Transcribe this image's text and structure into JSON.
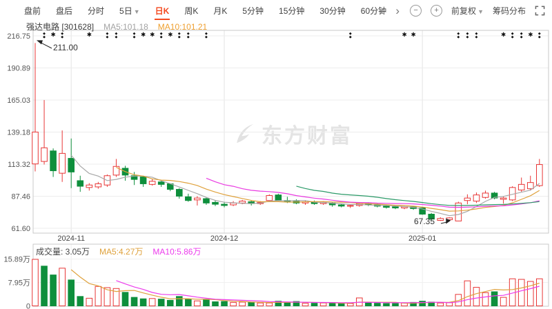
{
  "toolbar": {
    "tabs": [
      {
        "label": "盘前"
      },
      {
        "label": "盘后"
      },
      {
        "label": "分时"
      },
      {
        "label": "5日",
        "caret": true
      },
      {
        "label": "日K",
        "active": true
      },
      {
        "label": "周K"
      },
      {
        "label": "月K"
      },
      {
        "label": "5分钟"
      },
      {
        "label": "15分钟"
      },
      {
        "label": "30分钟"
      },
      {
        "label": "60分钟"
      }
    ],
    "controls": {
      "prev": "‹",
      "next": "›",
      "zoom_out": "−",
      "zoom_in": "+",
      "adjust_label": "前复权",
      "chip_label": "筹码分布"
    }
  },
  "legend": {
    "stock_name": "强达电路",
    "stock_code": "[301628]",
    "ma5": "MA5:101.18",
    "ma10": "MA10:101.21"
  },
  "volume_legend": {
    "volume": "成交量: 3.05万",
    "ma5": "MA5:4.27万",
    "ma10": "MA10:5.86万"
  },
  "watermark": "东方财富",
  "annotations": {
    "high": "211.00",
    "low": "67.35"
  },
  "colors": {
    "up_red": "#e83535",
    "down_green": "#0e8f3c",
    "active_tab_red": "#f4491f",
    "price_ma5_gray": "#a8a8a8",
    "price_ma10_orange": "#dfa13b",
    "price_ma20_magenta": "#e93ae1",
    "price_ma30_green": "#2b9a68",
    "volume_ma5_orange": "#dfa13b",
    "volume_ma10_magenta": "#ec3bec",
    "grid": "#ececec",
    "border": "#c9c9c9",
    "tick_text": "#555555"
  },
  "chart_data": {
    "type": "candlestick",
    "title": "强达电路 [301628] 日K",
    "legend_position": "top-left",
    "grid": true,
    "price_axis": {
      "tick_labels": [
        "216.75",
        "190.89",
        "165.03",
        "139.18",
        "113.32",
        "87.46",
        "61.60"
      ],
      "tick_values": [
        216.75,
        190.89,
        165.03,
        139.18,
        113.32,
        87.46,
        61.6
      ],
      "range": [
        61.6,
        216.75
      ]
    },
    "volume_axis": {
      "tick_labels": [
        "15.89万",
        "7.95万",
        "0"
      ],
      "tick_values_wan": [
        15.89,
        7.95,
        0
      ],
      "unit": "万"
    },
    "x_axis": {
      "month_labels": [
        "2024-11",
        "2024-12",
        "2025-01"
      ],
      "month_label_indices": [
        4,
        21,
        43
      ]
    },
    "high_annotation": {
      "value": 211.0,
      "index": 0
    },
    "low_annotation": {
      "value": 67.35,
      "index": 46
    },
    "candles_ohlcv": [
      [
        113.5,
        211,
        107.5,
        139.2,
        15.8
      ],
      [
        115.5,
        165,
        113,
        126.5,
        13.5
      ],
      [
        124,
        126,
        103,
        108,
        10.5
      ],
      [
        106,
        140.5,
        99,
        122,
        12.8
      ],
      [
        118,
        134,
        94,
        107,
        8.8
      ],
      [
        100,
        104,
        91,
        95.5,
        3.2
      ],
      [
        94.5,
        98,
        92,
        96.5,
        2.6
      ],
      [
        95,
        99,
        93.5,
        97.5,
        6.6
      ],
      [
        96.5,
        105,
        95,
        104,
        6.2
      ],
      [
        104.5,
        117.5,
        103,
        111.5,
        5.9
      ],
      [
        110,
        112,
        100,
        104.5,
        4.6
      ],
      [
        104,
        107,
        96.5,
        101,
        2.9
      ],
      [
        103,
        104,
        95,
        97.5,
        2.4
      ],
      [
        97,
        101.5,
        96,
        99.5,
        2.5
      ],
      [
        99,
        100.5,
        95,
        97,
        2.3
      ],
      [
        97.5,
        98,
        91.5,
        93,
        1.9
      ],
      [
        93,
        94,
        85.5,
        87.5,
        3.2
      ],
      [
        87,
        89.5,
        83,
        84,
        2.3
      ],
      [
        84.5,
        87.5,
        80,
        86,
        1.7
      ],
      [
        85.5,
        86.5,
        80.5,
        82,
        2.1
      ],
      [
        82.5,
        84,
        79.5,
        81,
        1.4
      ],
      [
        81,
        83,
        78.5,
        80,
        1.5
      ],
      [
        80.5,
        83.5,
        79.5,
        82,
        1.2
      ],
      [
        82,
        84.5,
        81,
        83.5,
        1.3
      ],
      [
        83,
        84,
        80,
        81.5,
        1.2
      ],
      [
        81.5,
        83.5,
        80.5,
        82.5,
        1.0
      ],
      [
        84,
        89,
        83.5,
        88,
        1.0
      ],
      [
        88.5,
        89.5,
        83.5,
        84,
        1.6
      ],
      [
        84,
        87,
        82,
        83,
        1.2
      ],
      [
        83.5,
        85,
        81,
        82,
        1.5
      ],
      [
        82,
        84,
        80.5,
        83,
        0.9
      ],
      [
        83,
        84,
        80.5,
        81.5,
        0.9
      ],
      [
        81.5,
        83.5,
        80.5,
        82.5,
        1.0
      ],
      [
        82,
        83,
        79,
        80.5,
        1.1
      ],
      [
        80.5,
        81.5,
        78.5,
        79.5,
        0.8
      ],
      [
        79.5,
        81,
        78,
        80,
        0.8
      ],
      [
        80,
        82.5,
        79,
        81.5,
        2.7
      ],
      [
        81.5,
        82.5,
        79.5,
        80.5,
        1.0
      ],
      [
        80.5,
        81.5,
        78.5,
        79.5,
        0.9
      ],
      [
        79.5,
        80.5,
        77.5,
        78.5,
        0.8
      ],
      [
        79,
        80,
        77,
        78,
        0.8
      ],
      [
        78,
        79.5,
        77,
        79,
        1.0
      ],
      [
        79,
        79.5,
        76.5,
        77.5,
        1.2
      ],
      [
        78,
        78.5,
        72.5,
        73,
        1.6
      ],
      [
        73,
        74,
        68,
        69,
        1.3
      ],
      [
        68,
        70.5,
        67.5,
        69.5,
        1.0
      ],
      [
        68.5,
        70.5,
        67.35,
        70,
        1.1
      ],
      [
        67.5,
        83,
        67.4,
        82,
        3.9
      ],
      [
        84,
        89,
        81,
        86,
        8.5
      ],
      [
        83.5,
        90.5,
        82,
        88.5,
        6.3
      ],
      [
        86.5,
        92,
        85.5,
        90,
        4.5
      ],
      [
        90,
        91,
        85,
        86,
        4.8
      ],
      [
        85,
        87.5,
        81.5,
        86,
        2.9
      ],
      [
        84.5,
        95.5,
        83.5,
        94.5,
        9.2
      ],
      [
        92.5,
        102.5,
        91,
        97,
        9.0
      ],
      [
        93.5,
        104,
        92,
        98.5,
        8.3
      ],
      [
        96,
        117.5,
        95,
        113,
        9.2
      ]
    ],
    "event_marker_indices": {
      "star": [
        2,
        6,
        12,
        13,
        15,
        41,
        42,
        52,
        55
      ],
      "double_diamond": [
        1,
        3,
        8,
        9,
        11,
        14,
        16,
        17,
        19,
        35,
        47,
        48,
        49,
        53,
        54,
        56
      ]
    },
    "moving_averages": {
      "price_windows": [
        5,
        10,
        20,
        30
      ],
      "volume_windows": [
        5,
        10
      ]
    }
  }
}
